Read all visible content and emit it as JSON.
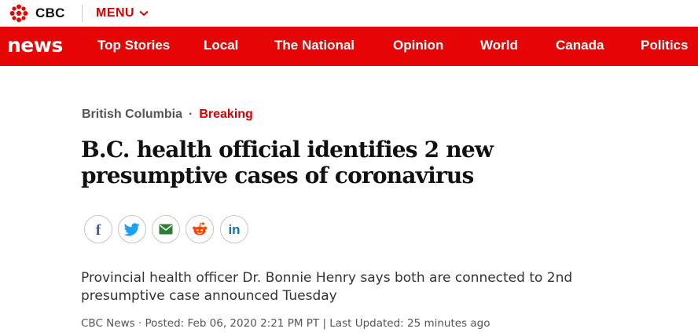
{
  "header": {
    "brand": "CBC",
    "menu_label": "MENU"
  },
  "nav": {
    "logo": "news",
    "items": [
      "Top Stories",
      "Local",
      "The National",
      "Opinion",
      "World",
      "Canada",
      "Politics"
    ]
  },
  "article": {
    "region": "British Columbia",
    "separator": "·",
    "tag": "Breaking",
    "headline": "B.C. health official identifies 2 new presumptive cases of coronavirus",
    "deck": "Provincial health officer Dr. Bonnie Henry says both are connected to 2nd presumptive case announced Tuesday",
    "byline": "CBC News · Posted: Feb 06, 2020 2:21 PM PT | Last Updated: 25 minutes ago"
  },
  "share": [
    {
      "icon": "facebook-icon",
      "color": "#3b5998"
    },
    {
      "icon": "twitter-icon",
      "color": "#1da1f2"
    },
    {
      "icon": "email-icon",
      "color": "#2e7d32"
    },
    {
      "icon": "reddit-icon",
      "color": "#ff4500"
    },
    {
      "icon": "linkedin-icon",
      "color": "#0e76a8"
    }
  ],
  "colors": {
    "brand_red": "#e60505",
    "accent_red": "#d50000"
  }
}
